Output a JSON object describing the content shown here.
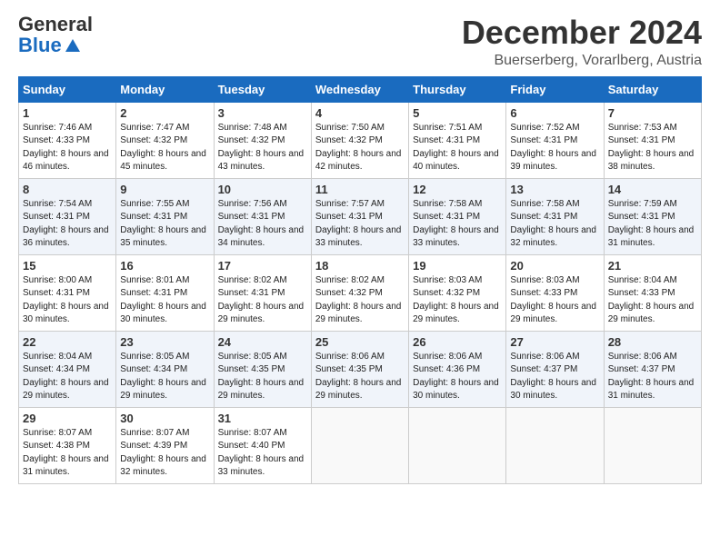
{
  "header": {
    "logo_line1": "General",
    "logo_line2": "Blue",
    "month": "December 2024",
    "location": "Buerserberg, Vorarlberg, Austria"
  },
  "days_of_week": [
    "Sunday",
    "Monday",
    "Tuesday",
    "Wednesday",
    "Thursday",
    "Friday",
    "Saturday"
  ],
  "weeks": [
    [
      {
        "day": "1",
        "sunrise": "7:46 AM",
        "sunset": "4:33 PM",
        "daylight": "8 hours and 46 minutes."
      },
      {
        "day": "2",
        "sunrise": "7:47 AM",
        "sunset": "4:32 PM",
        "daylight": "8 hours and 45 minutes."
      },
      {
        "day": "3",
        "sunrise": "7:48 AM",
        "sunset": "4:32 PM",
        "daylight": "8 hours and 43 minutes."
      },
      {
        "day": "4",
        "sunrise": "7:50 AM",
        "sunset": "4:32 PM",
        "daylight": "8 hours and 42 minutes."
      },
      {
        "day": "5",
        "sunrise": "7:51 AM",
        "sunset": "4:31 PM",
        "daylight": "8 hours and 40 minutes."
      },
      {
        "day": "6",
        "sunrise": "7:52 AM",
        "sunset": "4:31 PM",
        "daylight": "8 hours and 39 minutes."
      },
      {
        "day": "7",
        "sunrise": "7:53 AM",
        "sunset": "4:31 PM",
        "daylight": "8 hours and 38 minutes."
      }
    ],
    [
      {
        "day": "8",
        "sunrise": "7:54 AM",
        "sunset": "4:31 PM",
        "daylight": "8 hours and 36 minutes."
      },
      {
        "day": "9",
        "sunrise": "7:55 AM",
        "sunset": "4:31 PM",
        "daylight": "8 hours and 35 minutes."
      },
      {
        "day": "10",
        "sunrise": "7:56 AM",
        "sunset": "4:31 PM",
        "daylight": "8 hours and 34 minutes."
      },
      {
        "day": "11",
        "sunrise": "7:57 AM",
        "sunset": "4:31 PM",
        "daylight": "8 hours and 33 minutes."
      },
      {
        "day": "12",
        "sunrise": "7:58 AM",
        "sunset": "4:31 PM",
        "daylight": "8 hours and 33 minutes."
      },
      {
        "day": "13",
        "sunrise": "7:58 AM",
        "sunset": "4:31 PM",
        "daylight": "8 hours and 32 minutes."
      },
      {
        "day": "14",
        "sunrise": "7:59 AM",
        "sunset": "4:31 PM",
        "daylight": "8 hours and 31 minutes."
      }
    ],
    [
      {
        "day": "15",
        "sunrise": "8:00 AM",
        "sunset": "4:31 PM",
        "daylight": "8 hours and 30 minutes."
      },
      {
        "day": "16",
        "sunrise": "8:01 AM",
        "sunset": "4:31 PM",
        "daylight": "8 hours and 30 minutes."
      },
      {
        "day": "17",
        "sunrise": "8:02 AM",
        "sunset": "4:31 PM",
        "daylight": "8 hours and 29 minutes."
      },
      {
        "day": "18",
        "sunrise": "8:02 AM",
        "sunset": "4:32 PM",
        "daylight": "8 hours and 29 minutes."
      },
      {
        "day": "19",
        "sunrise": "8:03 AM",
        "sunset": "4:32 PM",
        "daylight": "8 hours and 29 minutes."
      },
      {
        "day": "20",
        "sunrise": "8:03 AM",
        "sunset": "4:33 PM",
        "daylight": "8 hours and 29 minutes."
      },
      {
        "day": "21",
        "sunrise": "8:04 AM",
        "sunset": "4:33 PM",
        "daylight": "8 hours and 29 minutes."
      }
    ],
    [
      {
        "day": "22",
        "sunrise": "8:04 AM",
        "sunset": "4:34 PM",
        "daylight": "8 hours and 29 minutes."
      },
      {
        "day": "23",
        "sunrise": "8:05 AM",
        "sunset": "4:34 PM",
        "daylight": "8 hours and 29 minutes."
      },
      {
        "day": "24",
        "sunrise": "8:05 AM",
        "sunset": "4:35 PM",
        "daylight": "8 hours and 29 minutes."
      },
      {
        "day": "25",
        "sunrise": "8:06 AM",
        "sunset": "4:35 PM",
        "daylight": "8 hours and 29 minutes."
      },
      {
        "day": "26",
        "sunrise": "8:06 AM",
        "sunset": "4:36 PM",
        "daylight": "8 hours and 30 minutes."
      },
      {
        "day": "27",
        "sunrise": "8:06 AM",
        "sunset": "4:37 PM",
        "daylight": "8 hours and 30 minutes."
      },
      {
        "day": "28",
        "sunrise": "8:06 AM",
        "sunset": "4:37 PM",
        "daylight": "8 hours and 31 minutes."
      }
    ],
    [
      {
        "day": "29",
        "sunrise": "8:07 AM",
        "sunset": "4:38 PM",
        "daylight": "8 hours and 31 minutes."
      },
      {
        "day": "30",
        "sunrise": "8:07 AM",
        "sunset": "4:39 PM",
        "daylight": "8 hours and 32 minutes."
      },
      {
        "day": "31",
        "sunrise": "8:07 AM",
        "sunset": "4:40 PM",
        "daylight": "8 hours and 33 minutes."
      },
      null,
      null,
      null,
      null
    ]
  ],
  "labels": {
    "sunrise": "Sunrise:",
    "sunset": "Sunset:",
    "daylight": "Daylight:"
  }
}
